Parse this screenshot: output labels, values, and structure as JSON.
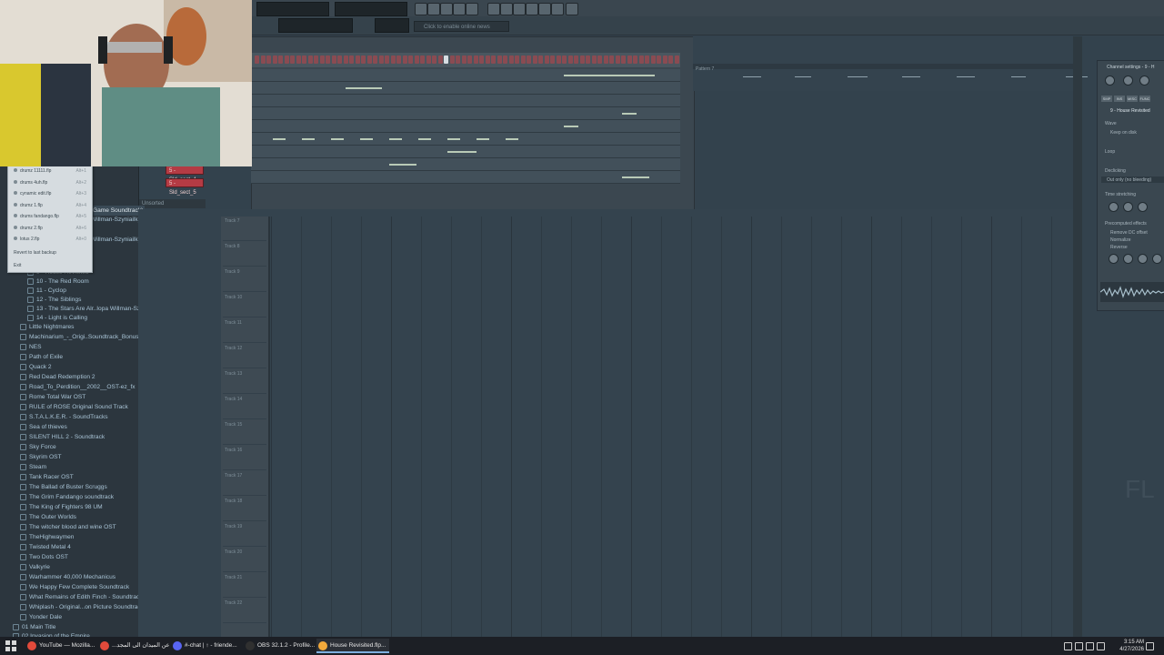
{
  "toolbar": {
    "hint": "Click to enable online news"
  },
  "channel_rack": {
    "channels": [
      "5 - Sld_sect_4",
      "5 - Sld_sect_5"
    ],
    "footer": "Unsorted"
  },
  "browser": {
    "items_top": [
      "Game Soundtrack)",
      "Willman-Szyniailk)",
      "Willman-Szyniailk)"
    ],
    "sub_items": [
      "9 - House Revisited",
      "10 - The Red Room",
      "11 - Cyclop",
      "12 - The Siblings",
      "13 - The Stars Are Alr..Iopa Willman-Szyniailk)",
      "14 - Light is Calling"
    ],
    "items": [
      "Little Nightmares",
      "Machinarium_-_Origi..Soundtrack_Bonus_EP",
      "NES",
      "Path of Exile",
      "Quack 2",
      "Red Dead Redemption 2",
      "Road_To_Perdition__2002__OST-ez_fx",
      "Rome Total War OST",
      "RULE of ROSE Original Sound Track",
      "S.T.A.L.K.E.R. - SoundTracks",
      "Sea of thieves",
      "SILENT HILL 2 - Soundtrack",
      "Sky Force",
      "Skyrim OST",
      "Steam",
      "Tank Racer OST",
      "The Ballad of Buster Scruggs",
      "The Grim Fandango soundtrack",
      "The King of Fighters 98 UM",
      "The Outer Worlds",
      "The witcher blood and wine OST",
      "TheHighwaymen",
      "Twisted Metal 4",
      "Two Dots OST",
      "Valkyrie",
      "Warhammer 40,000 Mechanicus",
      "We Happy Few Complete Soundtrack",
      "What Remains of Edith Finch - Soundtrack",
      "Whiplash - Original...on Picture Soundtrack",
      "Yonder Dale"
    ],
    "footer_items": [
      "01 Main Title",
      "02 Invasion of the Empire"
    ]
  },
  "recent_menu": {
    "items": [
      {
        "label": "drumz 11111.flp",
        "key": "Alt+1"
      },
      {
        "label": "drums 4uh.flp",
        "key": "Alt+2"
      },
      {
        "label": "cynamic edit.flp",
        "key": "Alt+3"
      },
      {
        "label": "drumz 1.flp",
        "key": "Alt+4"
      },
      {
        "label": "drums fandango.flp",
        "key": "Alt+5"
      },
      {
        "label": "drumz 2.flp",
        "key": "Alt+6"
      },
      {
        "label": "lotus 2.flp",
        "key": "Alt+0"
      }
    ],
    "revert": "Revert to last backup",
    "exit": "Exit"
  },
  "playlist": {
    "pattern_label": "Pattern 7",
    "tracks": [
      "Track 7",
      "Track 8",
      "Track 9",
      "Track 10",
      "Track 11",
      "Track 12",
      "Track 13",
      "Track 14",
      "Track 15",
      "Track 16",
      "Track 17",
      "Track 18",
      "Track 19",
      "Track 20",
      "Track 21",
      "Track 22"
    ],
    "watermark": "FL"
  },
  "channel_settings": {
    "title": "Channel settings - 9 - H",
    "tabs": [
      "SMP",
      "INS",
      "MISC",
      "FUNC"
    ],
    "sample": "9 - House Revisited",
    "wave": "Wave",
    "keep": "Keep on disk",
    "loop": "Loop",
    "declicking": "Declicking",
    "declick_mode": "Out only (no bleeding)",
    "time_stretch": "Time stretching",
    "precomputed": "Precomputed effects",
    "fx": [
      "Remove DC offset",
      "Normalize",
      "Reverse"
    ]
  },
  "taskbar": {
    "tasks": [
      {
        "label": "YouTube — Mozilla...",
        "color": "#e24a3b"
      },
      {
        "label": "...عن الميدان الى المجد",
        "color": "#e24a3b"
      },
      {
        "label": "#-chat | ↑ - friende...",
        "color": "#5865f2"
      },
      {
        "label": "OBS 32.1.2 - Profile...",
        "color": "#303030"
      },
      {
        "label": "House Revisited.flp...",
        "color": "#f2a93b"
      }
    ],
    "time": "3:15 AM",
    "date": "4/27/2026"
  }
}
